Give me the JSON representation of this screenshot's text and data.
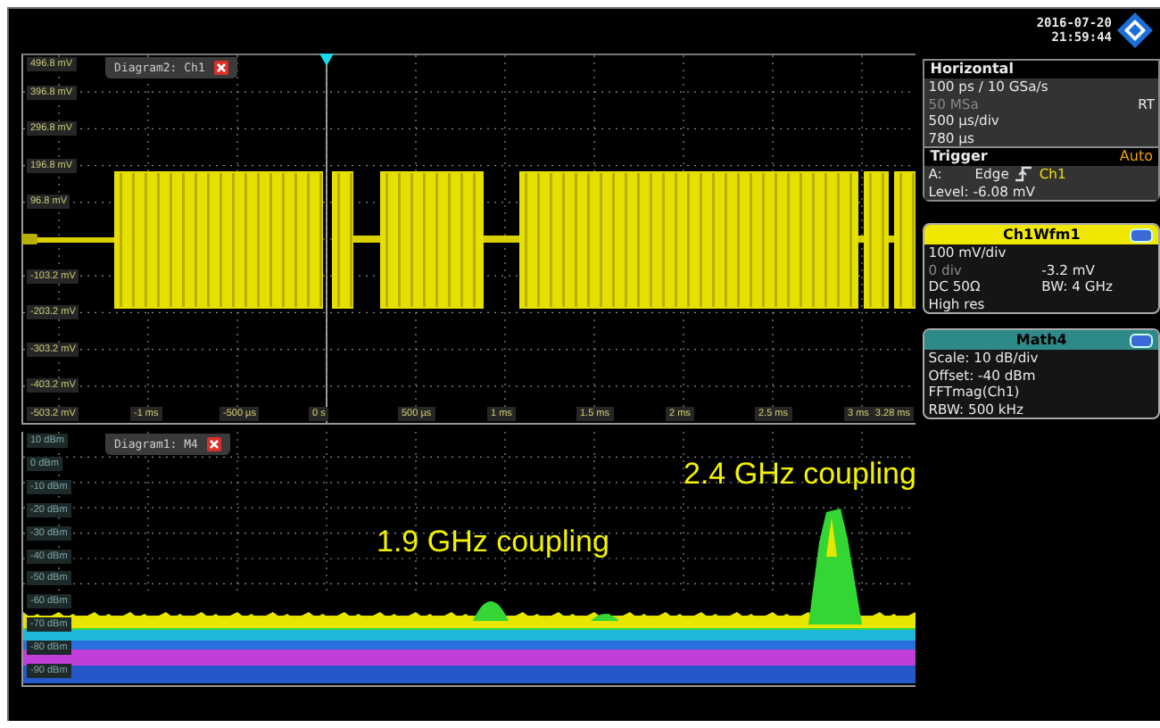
{
  "header": {
    "date": "2016-07-20",
    "time": "21:59:44"
  },
  "diagrams": [
    {
      "kind": "time",
      "title": "Diagram2: Ch1",
      "y_labels": [
        "496.8 mV",
        "396.8 mV",
        "296.8 mV",
        "196.8 mV",
        "96.8 mV",
        "-103.2 mV",
        "-203.2 mV",
        "-303.2 mV",
        "-403.2 mV",
        "-503.2 mV"
      ],
      "x_labels": [
        "-1 ms",
        "-500 µs",
        "0 s",
        "500 µs",
        "1 ms",
        "1.5 ms",
        "2 ms",
        "2.5 ms",
        "3 ms",
        "3.28 ms"
      ]
    },
    {
      "kind": "spectrum",
      "title": "Diagram1: M4",
      "y_labels": [
        "10 dBm",
        "0 dBm",
        "-10 dBm",
        "-20 dBm",
        "-30 dBm",
        "-40 dBm",
        "-50 dBm",
        "-60 dBm",
        "-70 dBm",
        "-80 dBm",
        "-90 dBm"
      ],
      "annotations": [
        "1.9 GHz coupling",
        "2.4 GHz coupling"
      ]
    }
  ],
  "horizontal": {
    "title": "Horizontal",
    "lines": [
      {
        "text": "100 ps / 10 GSa/s",
        "dim": false
      },
      {
        "text": "50 MSa",
        "dim": true,
        "right": "RT"
      },
      {
        "text": "500 µs/div",
        "dim": false
      },
      {
        "text": "780 µs",
        "dim": false
      }
    ]
  },
  "trigger": {
    "title": "Trigger",
    "mode": "Auto",
    "source_label": "A:",
    "type": "Edge",
    "source": "Ch1",
    "level": "Level: -6.08 mV"
  },
  "channels": [
    {
      "kind": "wave",
      "title": "Ch1Wfm1",
      "rows": [
        [
          "100 mV/div"
        ],
        [
          "0 div",
          "-3.2 mV"
        ],
        [
          "DC 50Ω",
          "BW: 4 GHz"
        ],
        [
          "High res"
        ]
      ]
    },
    {
      "kind": "math",
      "title": "Math4",
      "rows": [
        [
          "Scale:  10 dB/div"
        ],
        [
          "Offset: -40 dBm"
        ],
        [
          "FFTmag(Ch1)"
        ],
        [
          "RBW:   500 kHz"
        ]
      ]
    }
  ]
}
